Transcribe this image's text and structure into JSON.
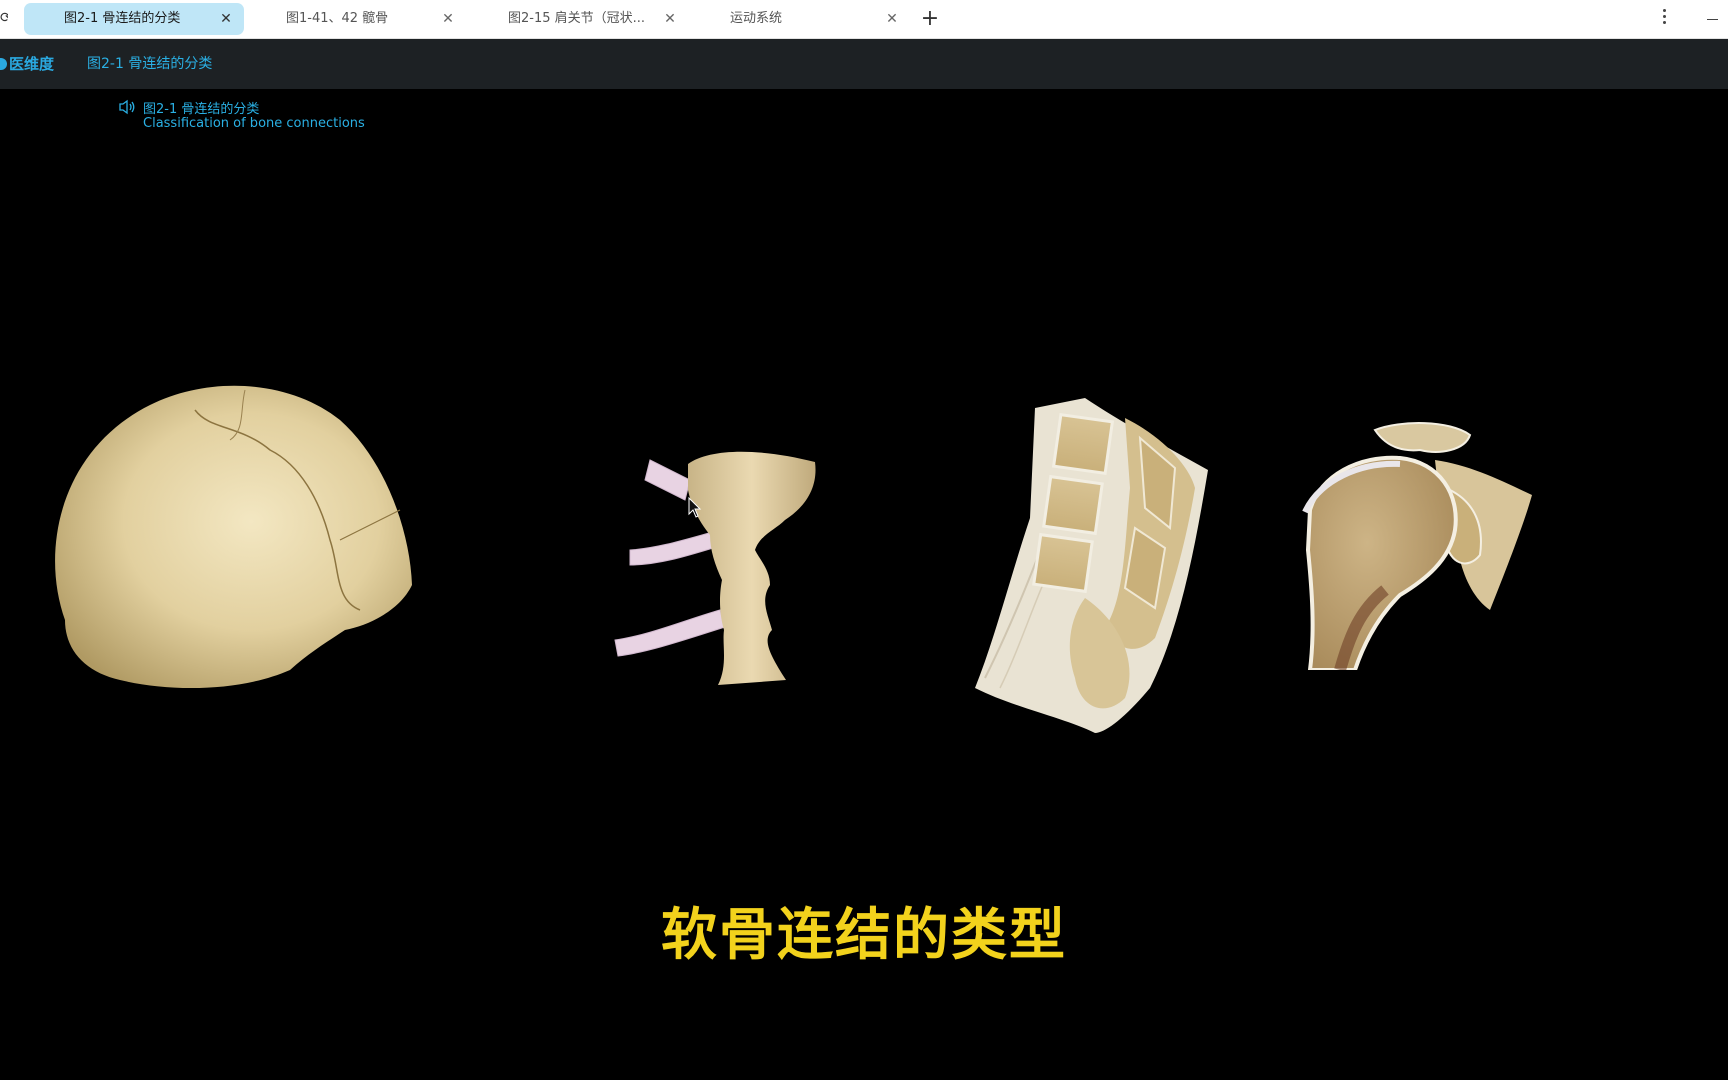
{
  "tabs": [
    {
      "label": "图2-1 骨连结的分类",
      "active": true
    },
    {
      "label": "图1-41、42 髋骨",
      "active": false
    },
    {
      "label": "图2-15 肩关节（冠状...",
      "active": false
    },
    {
      "label": "运动系统",
      "active": false
    }
  ],
  "toolbar": {
    "new_tab_icon": "plus-icon",
    "menu_icon": "more-vertical-icon",
    "minimize_icon": "minimize-icon"
  },
  "app": {
    "brand": "医维度",
    "title": "图2-1 骨连结的分类"
  },
  "caption": {
    "icon": "speaker-icon",
    "title_cn": "图2-1 骨连结的分类",
    "title_en": "Classification of bone connections"
  },
  "viewer": {
    "models": [
      "skull-model",
      "sternum-ribs-model",
      "spine-section-model",
      "shoulder-joint-model"
    ],
    "subtitle": "软骨连结的类型"
  },
  "colors": {
    "accent": "#2ab0e4",
    "active_tab": "#bfe6f7",
    "app_bar": "#1d2124",
    "subtitle": "#f2d21c",
    "bone": "#e6d7ad",
    "cartilage": "#e8cfe0"
  }
}
